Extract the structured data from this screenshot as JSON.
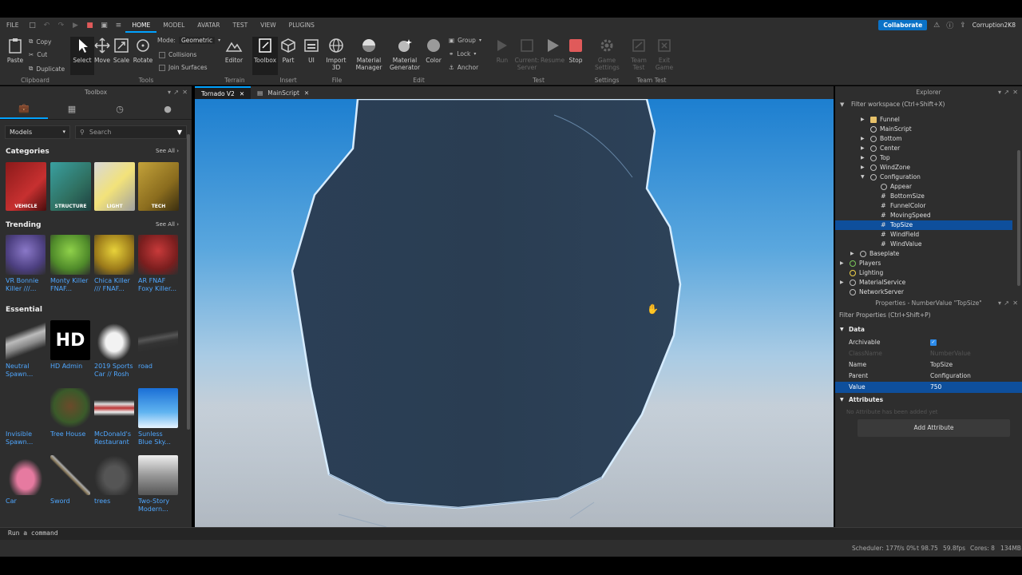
{
  "menu": {
    "file": "FILE",
    "tabs": [
      "HOME",
      "MODEL",
      "AVATAR",
      "TEST",
      "VIEW",
      "PLUGINS"
    ],
    "collaborate": "Collaborate",
    "username": "Corruption2K8"
  },
  "ribbon": {
    "clipboard": {
      "paste": "Paste",
      "copy": "Copy",
      "cut": "Cut",
      "duplicate": "Duplicate",
      "label": "Clipboard"
    },
    "tools": {
      "select": "Select",
      "move": "Move",
      "scale": "Scale",
      "rotate": "Rotate",
      "mode_label": "Mode:",
      "mode_value": "Geometric",
      "collisions": "Collisions",
      "join_surfaces": "Join Surfaces",
      "label": "Tools"
    },
    "terrain": {
      "editor": "Editor",
      "label": "Terrain"
    },
    "insert": {
      "toolbox": "Toolbox",
      "part": "Part",
      "ui": "UI",
      "label": "Insert"
    },
    "file": {
      "import": "Import 3D",
      "label": "File"
    },
    "edit": {
      "material_manager": "Material Manager",
      "material_generator": "Material Generator",
      "color": "Color",
      "group": "Group",
      "lock": "Lock",
      "anchor": "Anchor",
      "label": "Edit"
    },
    "test": {
      "run": "Run",
      "current_server": "Current: Server",
      "resume": "Resume",
      "stop": "Stop",
      "label": "Test"
    },
    "settings": {
      "game_settings": "Game Settings",
      "label": "Settings"
    },
    "team_test": {
      "team_test": "Team Test",
      "exit_game": "Exit Game",
      "label": "Team Test"
    }
  },
  "toolbox": {
    "title": "Toolbox",
    "category_dropdown": "Models",
    "search_placeholder": "Search",
    "categories_title": "Categories",
    "see_all": "See All ›",
    "categories": [
      "VEHICLE",
      "STRUCTURE",
      "LIGHT",
      "TECH"
    ],
    "trending_title": "Trending",
    "trending": [
      {
        "line1": "VR Bonnie",
        "line2": "Killer ///..."
      },
      {
        "line1": "Monty Killer",
        "line2": "FNAF..."
      },
      {
        "line1": "Chica Killer",
        "line2": "/// FNAF..."
      },
      {
        "line1": "AR FNAF",
        "line2": "Foxy Killer..."
      }
    ],
    "essential_title": "Essential",
    "essential": [
      {
        "line1": "Neutral",
        "line2": "Spawn..."
      },
      {
        "line1": "HD Admin",
        "line2": ""
      },
      {
        "line1": "2019 Sports",
        "line2": "Car // Rosh"
      },
      {
        "line1": "road",
        "line2": ""
      },
      {
        "line1": "Invisible",
        "line2": "Spawn..."
      },
      {
        "line1": "Tree House",
        "line2": ""
      },
      {
        "line1": "McDonald's",
        "line2": "Restaurant"
      },
      {
        "line1": "Sunless",
        "line2": "Blue Sky..."
      },
      {
        "line1": "Car",
        "line2": ""
      },
      {
        "line1": "Sword",
        "line2": ""
      },
      {
        "line1": "trees",
        "line2": ""
      },
      {
        "line1": "Two-Story",
        "line2": "Modern..."
      }
    ],
    "hd_text": "HD"
  },
  "doc_tabs": [
    "Tornado V2",
    "MainScript"
  ],
  "explorer": {
    "title": "Explorer",
    "filter": "Filter workspace (Ctrl+Shift+X)",
    "items": [
      "Funnel",
      "MainScript",
      "Bottom",
      "Center",
      "Top",
      "WindZone",
      "Configuration",
      "Appear",
      "BottomSize",
      "FunnelColor",
      "MovingSpeed",
      "TopSize",
      "WindField",
      "WindValue",
      "Baseplate",
      "Players",
      "Lighting",
      "MaterialService",
      "NetworkServer"
    ]
  },
  "properties": {
    "title": "Properties - NumberValue \"TopSize\"",
    "filter": "Filter Properties (Ctrl+Shift+P)",
    "data_cat": "Data",
    "rows": [
      {
        "k": "Archivable",
        "v": ""
      },
      {
        "k": "ClassName",
        "v": "NumberValue"
      },
      {
        "k": "Name",
        "v": "TopSize"
      },
      {
        "k": "Parent",
        "v": "Configuration"
      },
      {
        "k": "Value",
        "v": "750"
      }
    ],
    "attr_cat": "Attributes",
    "no_attr": "No Attribute has been added yet",
    "add_attr": "Add Attribute"
  },
  "command_bar": {
    "placeholder": "Run a command"
  },
  "status": {
    "scheduler": "Scheduler: 177f/s 0%",
    "t": "t 98.75",
    "fps": "59.8fps",
    "cores": "Cores: 8",
    "mem": "134MB"
  }
}
